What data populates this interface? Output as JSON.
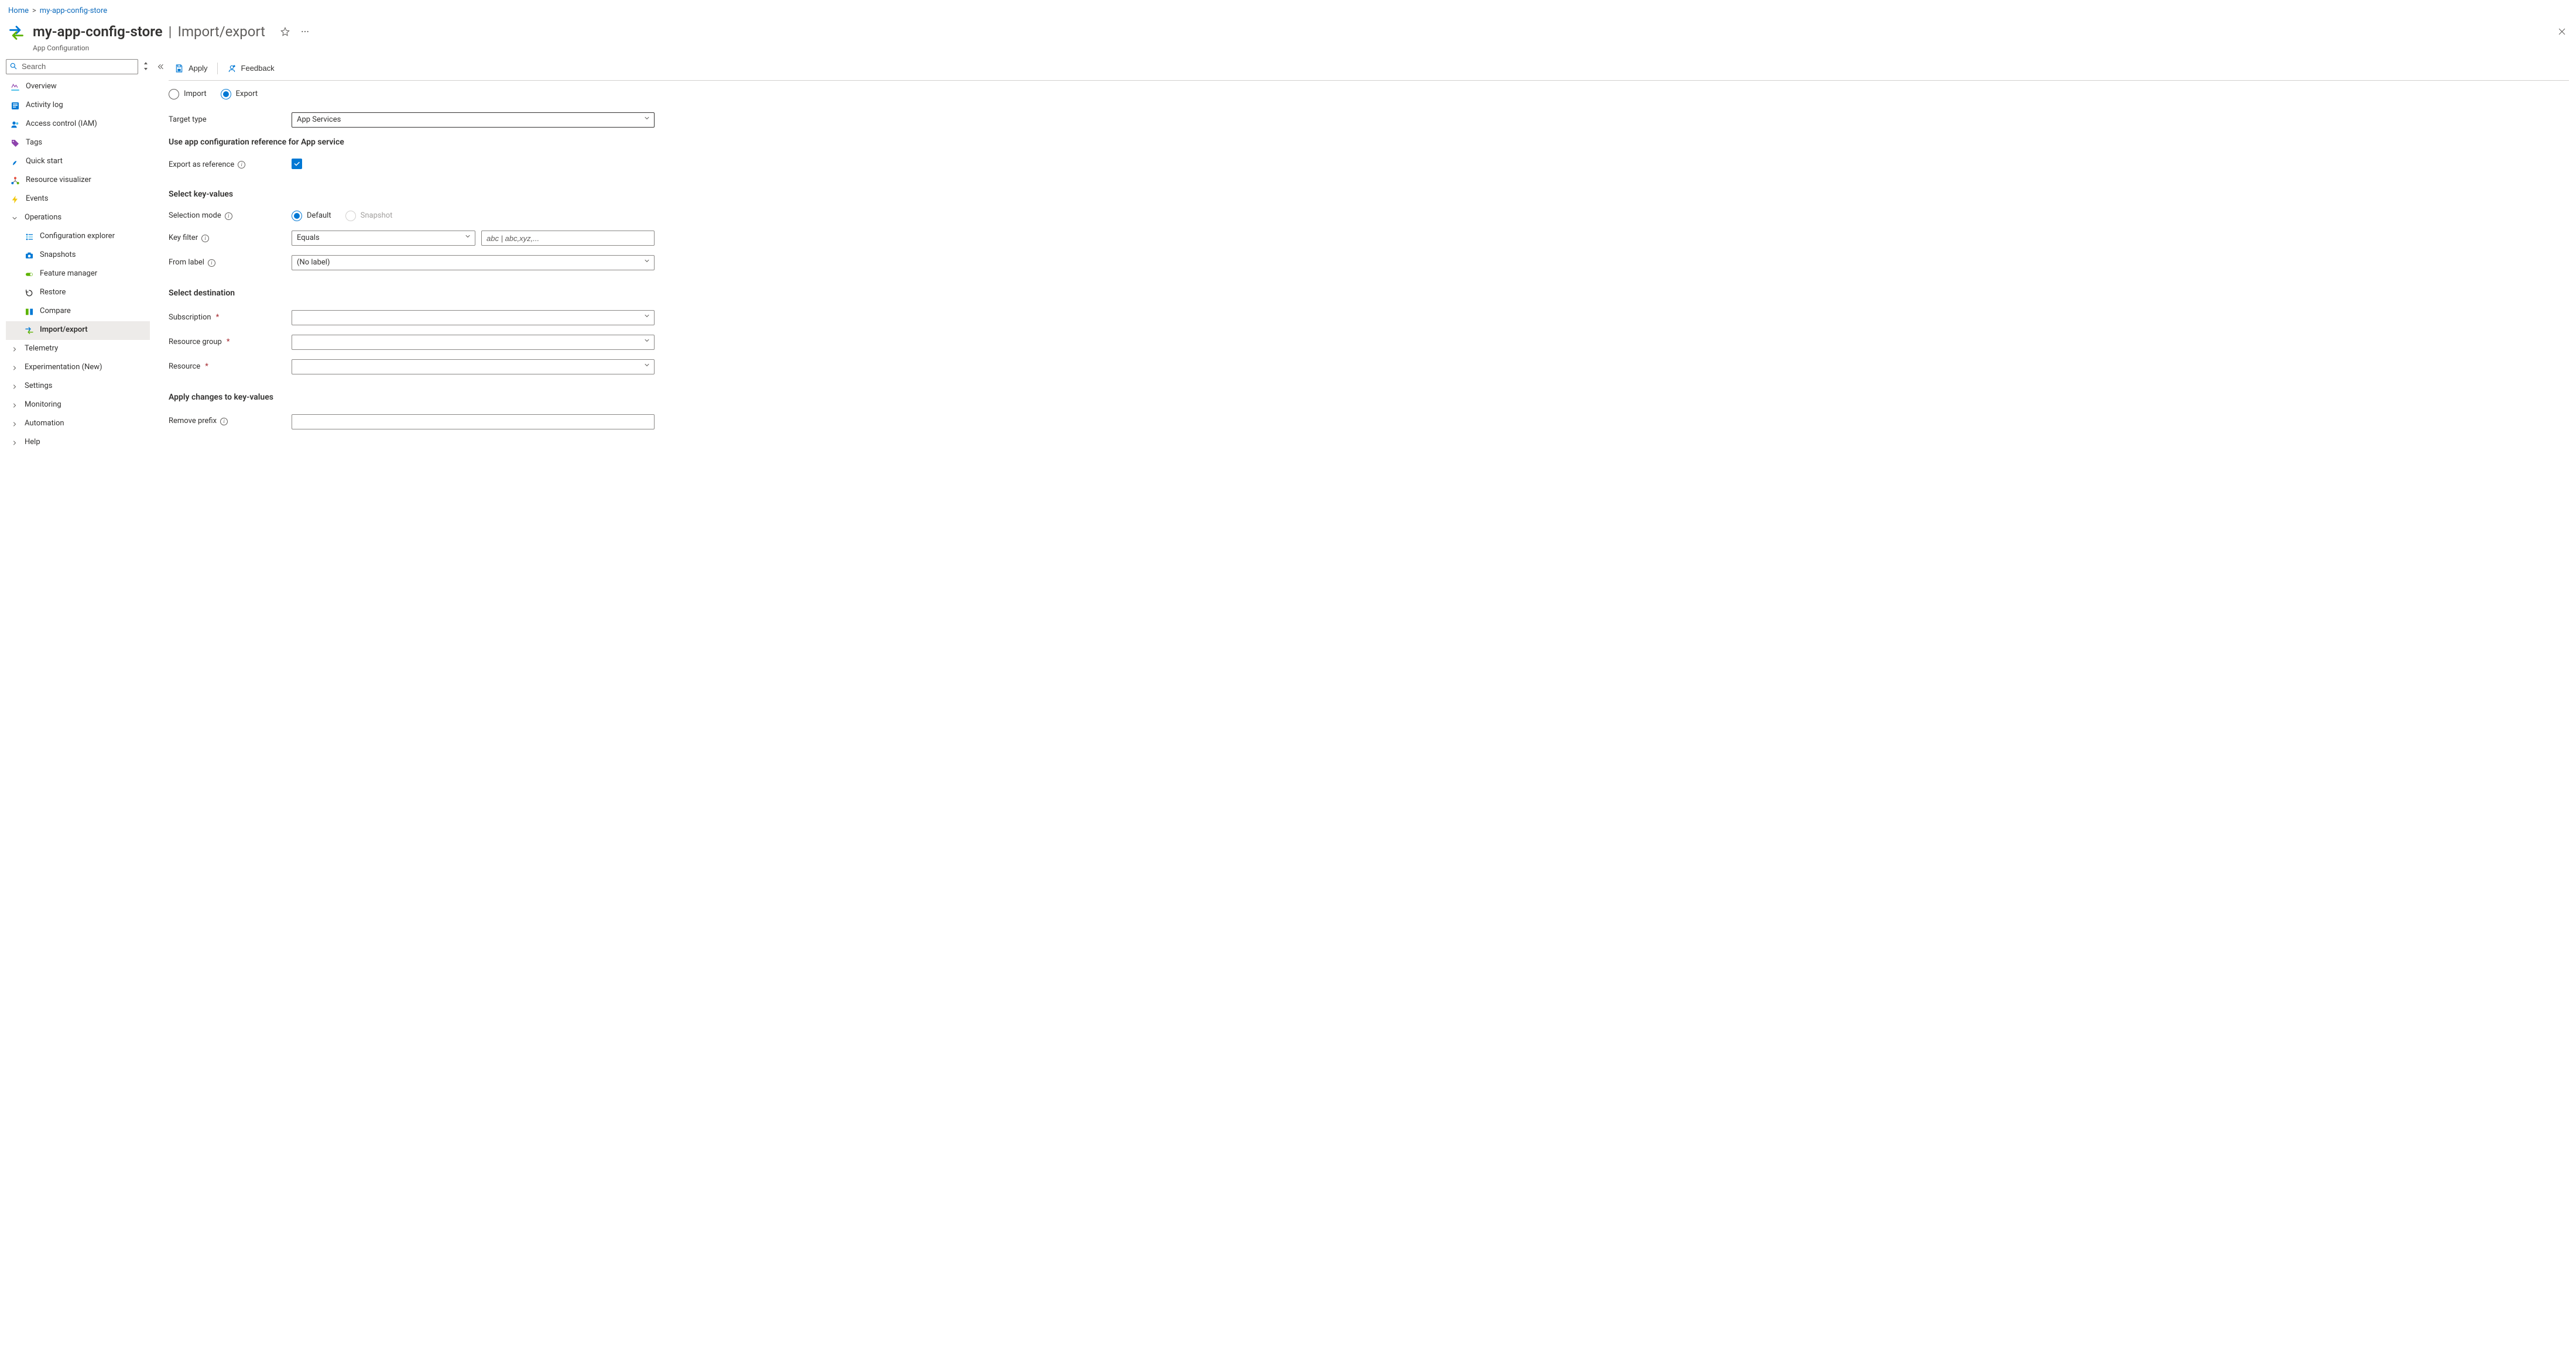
{
  "breadcrumb": {
    "home": "Home",
    "store": "my-app-config-store"
  },
  "header": {
    "store_name": "my-app-config-store",
    "page_name": "Import/export",
    "subtitle": "App Configuration"
  },
  "sidebar": {
    "search_placeholder": "Search",
    "items": [
      {
        "label": "Overview",
        "icon": "overview"
      },
      {
        "label": "Activity log",
        "icon": "activity"
      },
      {
        "label": "Access control (IAM)",
        "icon": "iam"
      },
      {
        "label": "Tags",
        "icon": "tags"
      },
      {
        "label": "Quick start",
        "icon": "quick"
      },
      {
        "label": "Resource visualizer",
        "icon": "visual"
      },
      {
        "label": "Events",
        "icon": "events"
      }
    ],
    "operations": {
      "label": "Operations",
      "items": [
        {
          "label": "Configuration explorer",
          "icon": "config"
        },
        {
          "label": "Snapshots",
          "icon": "snapshots"
        },
        {
          "label": "Feature manager",
          "icon": "feature"
        },
        {
          "label": "Restore",
          "icon": "restore"
        },
        {
          "label": "Compare",
          "icon": "compare"
        },
        {
          "label": "Import/export",
          "icon": "impexp"
        }
      ]
    },
    "groups": [
      {
        "label": "Telemetry"
      },
      {
        "label": "Experimentation (New)"
      },
      {
        "label": "Settings"
      },
      {
        "label": "Monitoring"
      },
      {
        "label": "Automation"
      },
      {
        "label": "Help"
      }
    ]
  },
  "toolbar": {
    "apply": "Apply",
    "feedback": "Feedback"
  },
  "form": {
    "radio_import": "Import",
    "radio_export": "Export",
    "target_type_label": "Target type",
    "target_type_value": "App Services",
    "section_ref": "Use app configuration reference for App service",
    "export_ref_label": "Export as reference",
    "section_select": "Select key-values",
    "selection_mode_label": "Selection mode",
    "selection_mode_default": "Default",
    "selection_mode_snapshot": "Snapshot",
    "key_filter_label": "Key filter",
    "key_filter_value": "Equals",
    "key_filter_placeholder": "abc | abc,xyz,...",
    "from_label_label": "From label",
    "from_label_value": "(No label)",
    "section_dest": "Select destination",
    "subscription_label": "Subscription",
    "resource_group_label": "Resource group",
    "resource_label": "Resource",
    "section_apply": "Apply changes to key-values",
    "remove_prefix_label": "Remove prefix"
  }
}
